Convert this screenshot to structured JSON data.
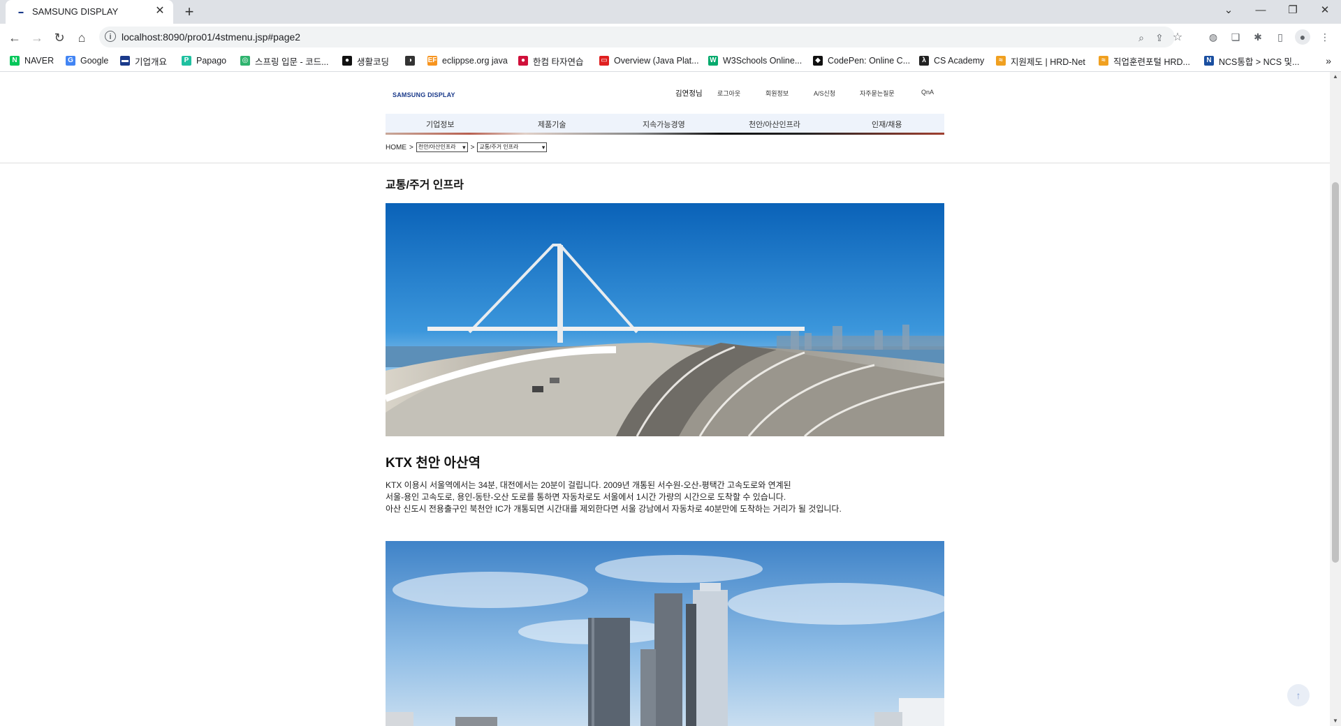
{
  "browser": {
    "tab_title": "SAMSUNG DISPLAY",
    "url": "localhost:8090/pro01/4stmenu.jsp#page2",
    "bookmarks": [
      {
        "label": "NAVER",
        "icon": "naver-icon",
        "color": "#03c75a",
        "glyph": "N"
      },
      {
        "label": "Google",
        "icon": "google-icon",
        "color": "#4285f4",
        "glyph": "G"
      },
      {
        "label": "기업개요",
        "icon": "samsung-icon",
        "color": "#1a3a8a",
        "glyph": "▬"
      },
      {
        "label": "Papago",
        "icon": "papago-icon",
        "color": "#1fc0a0",
        "glyph": "P"
      },
      {
        "label": "스프링 입문 - 코드...",
        "icon": "inflearn-icon",
        "color": "#2fb36e",
        "glyph": "◎"
      },
      {
        "label": "생활코딩",
        "icon": "circle-icon",
        "color": "#111111",
        "glyph": "●"
      },
      {
        "label": "",
        "icon": "globe-icon",
        "color": "#333333",
        "glyph": "◑"
      },
      {
        "label": "eclippse.org java",
        "icon": "eclipse-icon",
        "color": "#f7941e",
        "glyph": "EF"
      },
      {
        "label": "한컴 타자연습",
        "icon": "hancom-icon",
        "color": "#d0103a",
        "glyph": "●"
      },
      {
        "label": "Overview (Java Plat...",
        "icon": "oracle-icon",
        "color": "#e02020",
        "glyph": "▭"
      },
      {
        "label": "W3Schools Online...",
        "icon": "w3schools-icon",
        "color": "#04aa6d",
        "glyph": "W"
      },
      {
        "label": "CodePen: Online C...",
        "icon": "codepen-icon",
        "color": "#111111",
        "glyph": "◆"
      },
      {
        "label": "CS Academy",
        "icon": "cs-academy-icon",
        "color": "#222222",
        "glyph": "λ"
      },
      {
        "label": "지원제도 | HRD-Net",
        "icon": "hrd-icon",
        "color": "#f0a020",
        "glyph": "≈"
      },
      {
        "label": "직업훈련포털 HRD...",
        "icon": "hrd-icon",
        "color": "#f0a020",
        "glyph": "≈"
      },
      {
        "label": "NCS통합 > NCS 및...",
        "icon": "ncs-icon",
        "color": "#1a4fa0",
        "glyph": "N"
      }
    ],
    "more_bookmarks": "»"
  },
  "site": {
    "logo": "SAMSUNG DISPLAY",
    "user_greeting": "김연정님",
    "util_links": [
      "로그아웃",
      "회원정보",
      "A/S신청",
      "자주묻는질문",
      "QnA"
    ],
    "gnb": [
      "기업정보",
      "제품기술",
      "지속가능경영",
      "천안/아산인프라",
      "인재/채용"
    ],
    "breadcrumb": {
      "home": "HOME",
      "sep": ">",
      "select1": "천안/아산인프라",
      "select2": "교통/주거 인프라"
    },
    "section_title": "교통/주거 인프라",
    "station_title": "KTX 천안 아산역",
    "desc_lines": [
      "KTX 이용시 서울역에서는 34분, 대전에서는 20분이 걸립니다. 2009년 개통된 서수원-오산-평택간 고속도로와 연계된",
      "서울-용인 고속도로, 용인-동탄-오산 도로를 통하면 자동차로도 서울에서 1시간 가량의 시간으로 도착할 수 있습니다.",
      "아산 신도시 전용출구인 북천안 IC가 개통되면 시간대를 제외한다면 서울 강남에서 자동차로 40분만에 도착하는 거리가 될 것입니다."
    ],
    "to_top": "↑"
  }
}
